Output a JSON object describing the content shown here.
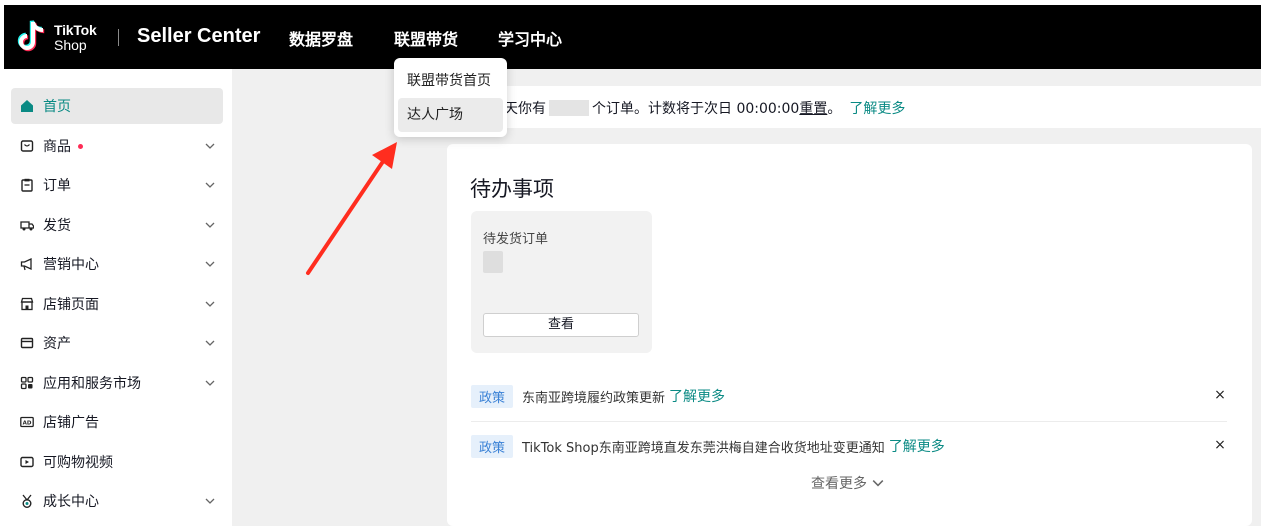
{
  "header": {
    "logo_line1": "TikTok",
    "logo_line2": "Shop",
    "brand": "Seller Center",
    "nav": [
      "数据罗盘",
      "联盟带货",
      "学习中心"
    ]
  },
  "dropdown": {
    "items": [
      "联盟带货首页",
      "达人广场"
    ],
    "hovered_index": 1
  },
  "sidebar": {
    "items": [
      {
        "label": "首页",
        "icon": "home-icon",
        "active": true,
        "expandable": false
      },
      {
        "label": "商品",
        "icon": "product-icon",
        "badge": true,
        "expandable": true
      },
      {
        "label": "订单",
        "icon": "order-icon",
        "expandable": true
      },
      {
        "label": "发货",
        "icon": "shipping-icon",
        "expandable": true
      },
      {
        "label": "营销中心",
        "icon": "megaphone-icon",
        "expandable": true
      },
      {
        "label": "店铺页面",
        "icon": "storefront-icon",
        "expandable": true
      },
      {
        "label": "资产",
        "icon": "wallet-icon",
        "expandable": true
      },
      {
        "label": "应用和服务市场",
        "icon": "apps-icon",
        "expandable": true
      },
      {
        "label": "店铺广告",
        "icon": "ad-icon",
        "expandable": false
      },
      {
        "label": "可购物视频",
        "icon": "video-icon",
        "expandable": false
      },
      {
        "label": "成长中心",
        "icon": "medal-icon",
        "expandable": true
      }
    ]
  },
  "banner": {
    "prefix": "天你有",
    "middle": "个订单。计数将于次日 00:00:00 ",
    "reset": "重置",
    "period": "。",
    "link": "了解更多"
  },
  "todo": {
    "title": "待办事项",
    "pending_card": {
      "title": "待发货订单",
      "button": "查看"
    },
    "policies": [
      {
        "tag": "政策",
        "text": "东南亚跨境履约政策更新",
        "link": "了解更多"
      },
      {
        "tag": "政策",
        "text": "TikTok Shop东南亚跨境直发东莞洪梅自建合收货地址变更通知",
        "link": "了解更多"
      }
    ],
    "close_symbol": "×",
    "more": "查看更多"
  },
  "colors": {
    "accent": "#0a8a84",
    "topbar": "#000000",
    "badge": "#fe2c55",
    "annotation_arrow": "#ff2d1f"
  }
}
